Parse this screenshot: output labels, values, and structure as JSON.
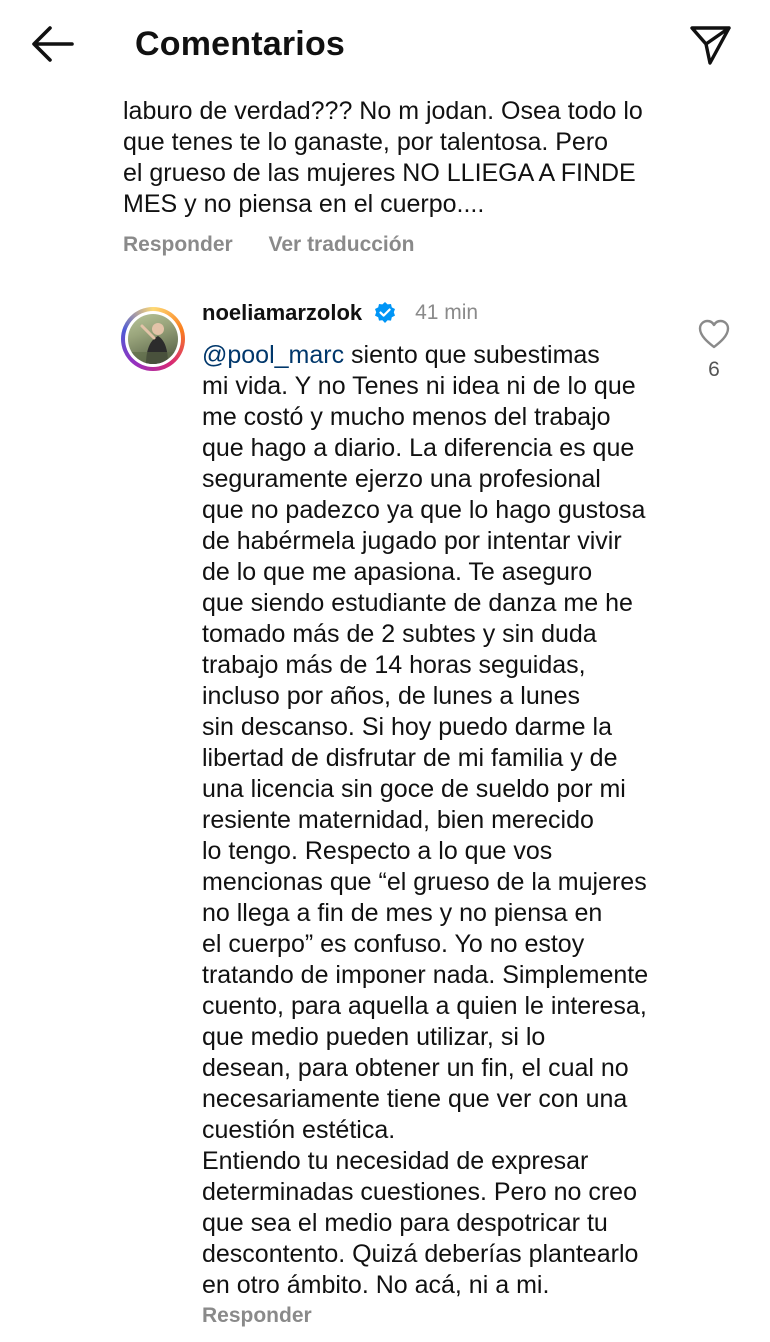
{
  "header": {
    "title": "Comentarios",
    "back_icon": "arrow-left-icon",
    "share_icon": "paper-plane-icon"
  },
  "previous_comment": {
    "lines": [
      "laburo de verdad??? No m jodan. Osea todo lo",
      "que tenes te lo ganaste, por talentosa. Pero",
      "el grueso de las mujeres NO LLIEGA A FINDE",
      "MES y no piensa en el cuerpo...."
    ],
    "reply_label": "Responder",
    "translate_label": "Ver traducción"
  },
  "reply_comment": {
    "username": "noeliamarzolok",
    "verified_icon": "verified-badge-icon",
    "time": "41 min",
    "mention": "@pool_marc",
    "first_line_rest": " siento que subestimas",
    "lines": [
      "mi vida. Y no Tenes ni idea ni de lo que",
      "me costó y mucho menos del trabajo",
      "que hago a diario. La diferencia es que",
      "seguramente ejerzo una profesional",
      "que no padezco ya que lo hago gustosa",
      "de habérmela jugado por intentar vivir",
      "de lo que me apasiona. Te aseguro",
      "que siendo estudiante de danza me he",
      "tomado más de 2 subtes y sin duda",
      "trabajo más de 14 horas seguidas,",
      "incluso por años, de lunes a lunes",
      "sin descanso. Si hoy puedo darme la",
      "libertad de disfrutar de mi familia y de",
      "una licencia sin goce de sueldo por mi",
      "resiente maternidad, bien merecido",
      "lo tengo. Respecto a lo que vos",
      "mencionas que “el grueso de la mujeres",
      "no llega a fin de mes y no piensa en",
      "el cuerpo” es confuso. Yo no estoy",
      "tratando de imponer nada. Simplemente",
      "cuento, para aquella a quien le interesa,",
      "que medio pueden utilizar, si lo",
      "desean, para obtener un fin, el cual no",
      "necesariamente  tiene que ver con una",
      "cuestión estética.",
      "Entiendo tu necesidad de expresar",
      "determinadas cuestiones. Pero no creo",
      "que sea el medio para despotricar tu",
      "descontento. Quizá deberías plantearlo",
      "en otro ámbito. No acá, ni a mi."
    ],
    "reply_label": "Responder",
    "like_icon": "heart-outline-icon",
    "like_count": "6"
  },
  "colors": {
    "text": "#111111",
    "muted": "#8a8a8a",
    "mention": "#00376b",
    "verified": "#0095f6"
  }
}
